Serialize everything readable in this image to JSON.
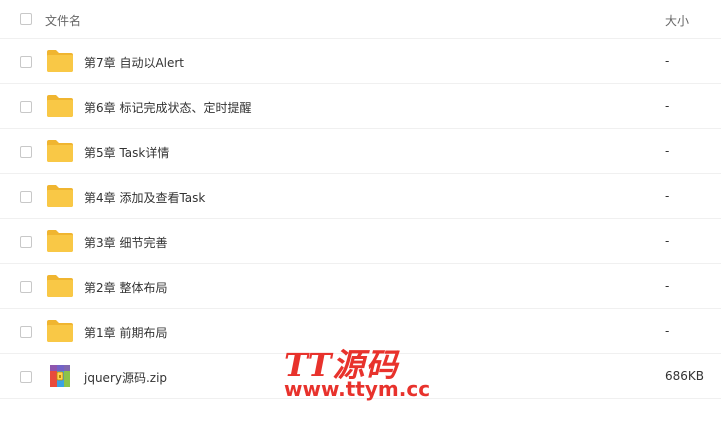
{
  "header": {
    "name_label": "文件名",
    "size_label": "大小"
  },
  "rows": [
    {
      "name": "第7章 自动以Alert",
      "size": "-",
      "icon": "folder-icon"
    },
    {
      "name": "第6章 标记完成状态、定时提醒",
      "size": "-",
      "icon": "folder-icon"
    },
    {
      "name": "第5章 Task详情",
      "size": "-",
      "icon": "folder-icon"
    },
    {
      "name": "第4章 添加及查看Task",
      "size": "-",
      "icon": "folder-icon"
    },
    {
      "name": "第3章 细节完善",
      "size": "-",
      "icon": "folder-icon"
    },
    {
      "name": "第2章 整体布局",
      "size": "-",
      "icon": "folder-icon"
    },
    {
      "name": "第1章 前期布局",
      "size": "-",
      "icon": "folder-icon"
    },
    {
      "name": "jquery源码.zip",
      "size": "686KB",
      "icon": "zip-archive-icon"
    }
  ],
  "watermark": {
    "title": "TT源码",
    "url": "www.ttym.cc"
  },
  "colors": {
    "folder": "#f9c846",
    "folder_tab": "#f0b530",
    "watermark": "#e8322c",
    "divider": "#f0f0f0"
  }
}
